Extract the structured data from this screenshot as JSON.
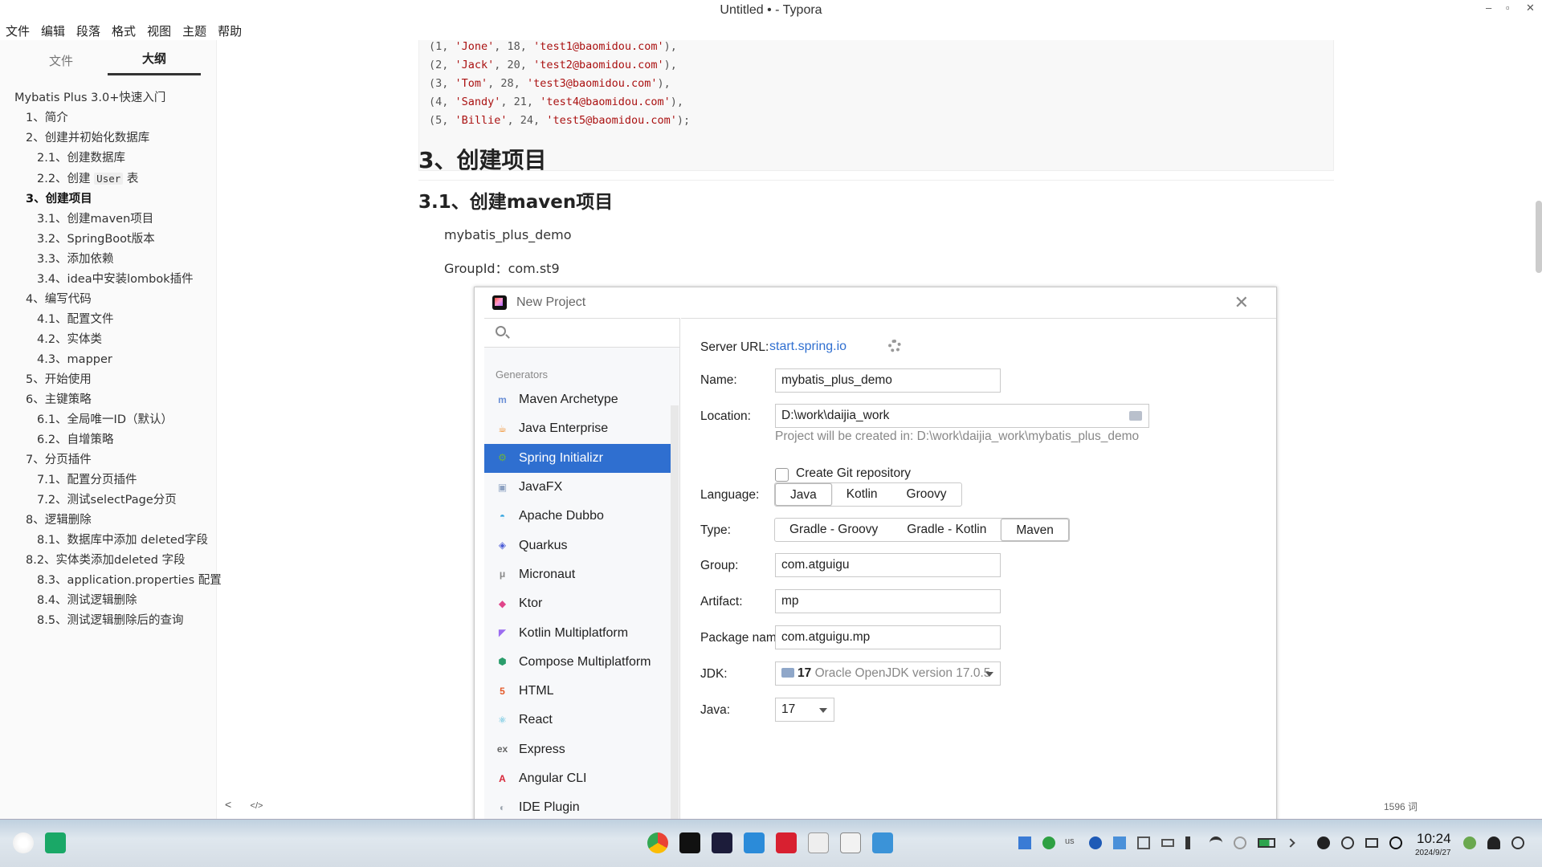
{
  "window": {
    "title": "Untitled • - Typora",
    "controls": {
      "minimize": "–",
      "maximize": "▫",
      "close": "✕"
    }
  },
  "menu": [
    "文件",
    "编辑",
    "段落",
    "格式",
    "视图",
    "主题",
    "帮助"
  ],
  "sidebar": {
    "tabs": [
      {
        "label": "文件",
        "active": false
      },
      {
        "label": "大纲",
        "active": true
      }
    ],
    "outline": [
      {
        "text": "Mybatis Plus 3.0+快速入门",
        "level": 1
      },
      {
        "text": "1、简介",
        "level": 2
      },
      {
        "text": "2、创建并初始化数据库",
        "level": 2
      },
      {
        "text": "2.1、创建数据库",
        "level": 3
      },
      {
        "text": "2.2、创建 ",
        "code": "User",
        "suffix": " 表",
        "level": 3
      },
      {
        "text": "3、创建项目",
        "level": 2,
        "bold": true
      },
      {
        "text": "3.1、创建maven项目",
        "level": 3
      },
      {
        "text": "3.2、SpringBoot版本",
        "level": 3
      },
      {
        "text": "3.3、添加依赖",
        "level": 3
      },
      {
        "text": "3.4、idea中安装lombok插件",
        "level": 3
      },
      {
        "text": "4、编写代码",
        "level": 2
      },
      {
        "text": "4.1、配置文件",
        "level": 3
      },
      {
        "text": "4.2、实体类",
        "level": 3
      },
      {
        "text": "4.3、mapper",
        "level": 3
      },
      {
        "text": "5、开始使用",
        "level": 2
      },
      {
        "text": "6、主键策略",
        "level": 2
      },
      {
        "text": "6.1、全局唯一ID（默认）",
        "level": 3
      },
      {
        "text": "6.2、自增策略",
        "level": 3
      },
      {
        "text": "7、分页插件",
        "level": 2
      },
      {
        "text": "7.1、配置分页插件",
        "level": 3
      },
      {
        "text": "7.2、测试selectPage分页",
        "level": 3
      },
      {
        "text": "8、逻辑删除",
        "level": 2
      },
      {
        "text": "8.1、数据库中添加 deleted字段",
        "level": 3
      },
      {
        "text": "8.2、实体类添加deleted 字段",
        "level": 2
      },
      {
        "text": "8.3、application.properties 配置",
        "level": 3
      },
      {
        "text": "8.4、测试逻辑删除",
        "level": 3
      },
      {
        "text": "8.5、测试逻辑删除后的查询",
        "level": 3
      }
    ],
    "footer_icons": [
      "<",
      "</>"
    ]
  },
  "editor": {
    "code_lines": [
      [
        "(1, ",
        "'Jone'",
        ", 18, ",
        "'test1@baomidou.com'",
        "),"
      ],
      [
        "(2, ",
        "'Jack'",
        ", 20, ",
        "'test2@baomidou.com'",
        "),"
      ],
      [
        "(3, ",
        "'Tom'",
        ", 28, ",
        "'test3@baomidou.com'",
        "),"
      ],
      [
        "(4, ",
        "'Sandy'",
        ", 21, ",
        "'test4@baomidou.com'",
        "),"
      ],
      [
        "(5, ",
        "'Billie'",
        ", 24, ",
        "'test5@baomidou.com'",
        ");"
      ]
    ],
    "h2": "3、创建项目",
    "h3": "3.1、创建maven项目",
    "para1": "mybatis_plus_demo",
    "para2": "GroupId：com.st9",
    "word_count": "1596 词"
  },
  "dialog": {
    "title": "New Project",
    "close": "✕",
    "search_placeholder": "",
    "generators_label": "Generators",
    "generators": [
      {
        "label": "Maven Archetype",
        "icon": "maven-icon",
        "glyph": "m",
        "color": "#6a8fd6",
        "selected": false
      },
      {
        "label": "Java Enterprise",
        "icon": "java-enterprise-icon",
        "glyph": "☕",
        "color": "#f08a24",
        "selected": false
      },
      {
        "label": "Spring Initializr",
        "icon": "spring-icon",
        "glyph": "⚙",
        "color": "#6db33f",
        "selected": true
      },
      {
        "label": "JavaFX",
        "icon": "javafx-icon",
        "glyph": "▣",
        "color": "#8ea2c2",
        "selected": false
      },
      {
        "label": "Apache Dubbo",
        "icon": "dubbo-icon",
        "glyph": "◓",
        "color": "#3aa7e0",
        "selected": false
      },
      {
        "label": "Quarkus",
        "icon": "quarkus-icon",
        "glyph": "◈",
        "color": "#4a5bd6",
        "selected": false
      },
      {
        "label": "Micronaut",
        "icon": "micronaut-icon",
        "glyph": "μ",
        "color": "#888888",
        "selected": false
      },
      {
        "label": "Ktor",
        "icon": "ktor-icon",
        "glyph": "◆",
        "color": "#e0458a",
        "selected": false
      },
      {
        "label": "Kotlin Multiplatform",
        "icon": "kotlin-icon",
        "glyph": "◤",
        "color": "#9b6cf0",
        "selected": false
      },
      {
        "label": "Compose Multiplatform",
        "icon": "compose-icon",
        "glyph": "⬢",
        "color": "#2a9d6b",
        "selected": false
      },
      {
        "label": "HTML",
        "icon": "html-icon",
        "glyph": "5",
        "color": "#e45a2a",
        "selected": false
      },
      {
        "label": "React",
        "icon": "react-icon",
        "glyph": "⚛",
        "color": "#44b7d8",
        "selected": false
      },
      {
        "label": "Express",
        "icon": "express-icon",
        "glyph": "ex",
        "color": "#666666",
        "selected": false
      },
      {
        "label": "Angular CLI",
        "icon": "angular-icon",
        "glyph": "A",
        "color": "#d8283a",
        "selected": false
      },
      {
        "label": "IDE Plugin",
        "icon": "ide-plugin-icon",
        "glyph": "◐",
        "color": "#9aa3ad",
        "selected": false
      }
    ],
    "form": {
      "server_url_label": "Server URL:",
      "server_url": "start.spring.io",
      "name_label": "Name:",
      "name": "mybatis_plus_demo",
      "location_label": "Location:",
      "location": "D:\\work\\daijia_work",
      "location_hint": "Project will be created in: D:\\work\\daijia_work\\mybatis_plus_demo",
      "git_label": "Create Git repository",
      "git_checked": false,
      "language_label": "Language:",
      "languages": [
        {
          "label": "Java",
          "on": true
        },
        {
          "label": "Kotlin",
          "on": false
        },
        {
          "label": "Groovy",
          "on": false
        }
      ],
      "type_label": "Type:",
      "types": [
        {
          "label": "Gradle - Groovy",
          "on": false
        },
        {
          "label": "Gradle - Kotlin",
          "on": false
        },
        {
          "label": "Maven",
          "on": true
        }
      ],
      "group_label": "Group:",
      "group": "com.atguigu",
      "artifact_label": "Artifact:",
      "artifact": "mp",
      "package_label": "Package name:",
      "package": "com.atguigu.mp",
      "jdk_label": "JDK:",
      "jdk_version": "17",
      "jdk_desc": "Oracle OpenJDK version 17.0.5",
      "java_label": "Java:",
      "java": "17"
    }
  },
  "taskbar": {
    "time": "10:24",
    "date": "2024/9/27",
    "ime": "us"
  }
}
